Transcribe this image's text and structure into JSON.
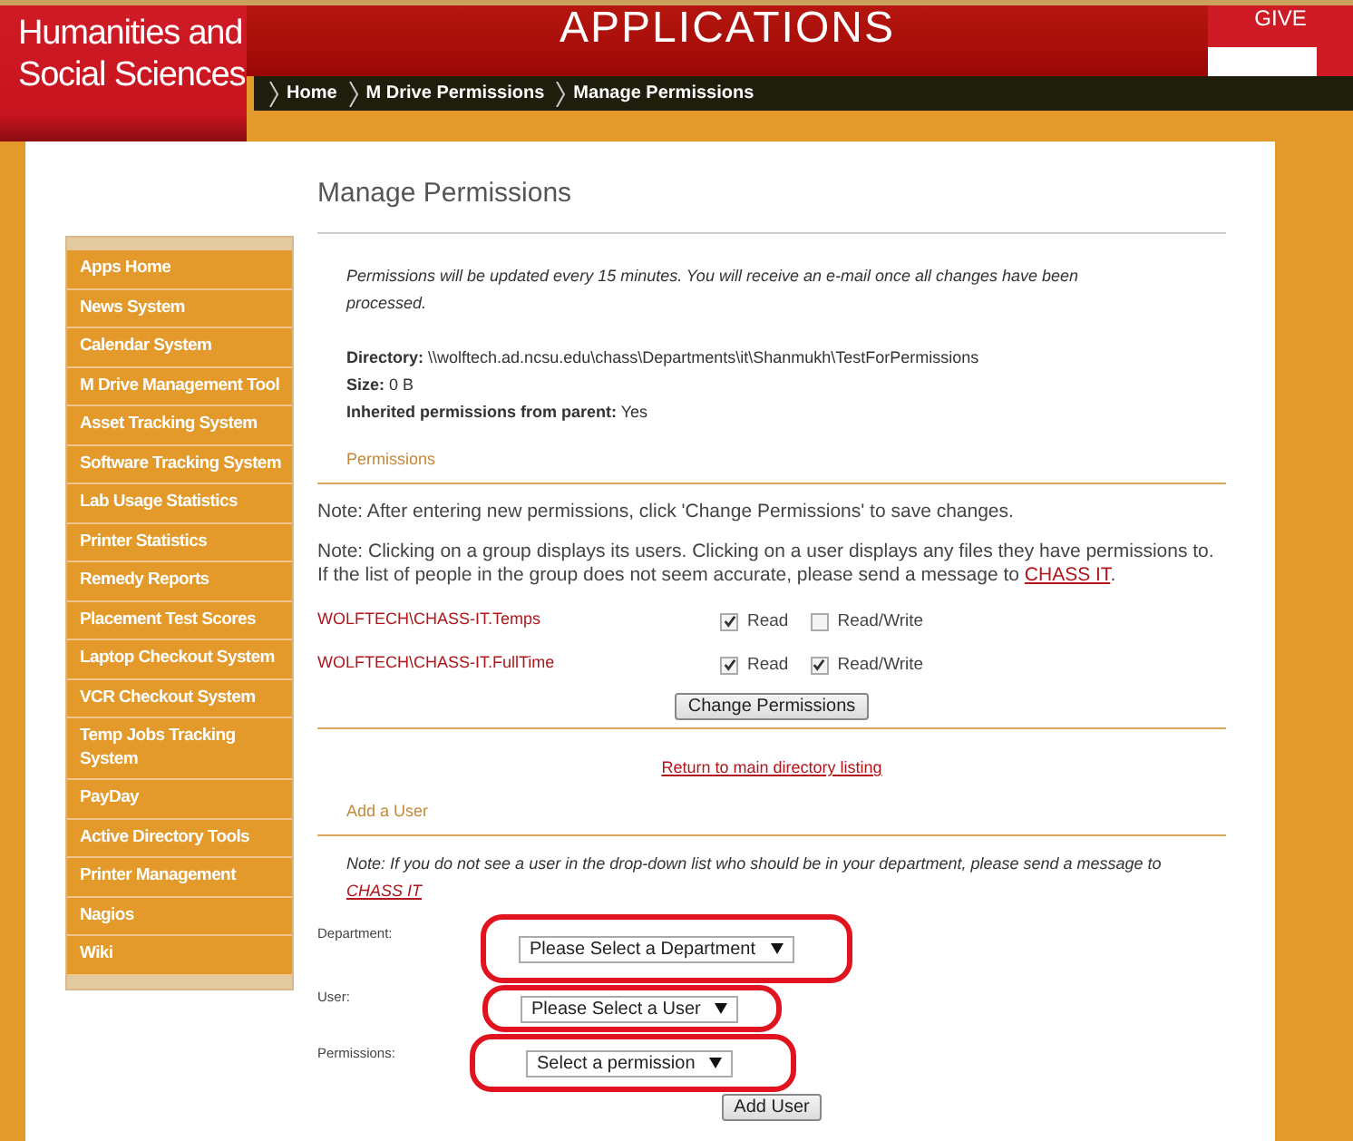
{
  "header": {
    "college": "Humanities and Social Sciences",
    "banner": "APPLICATIONS",
    "corner": "GIVE"
  },
  "breadcrumbs": [
    "Home",
    "M Drive Permissions",
    "Manage Permissions"
  ],
  "sidebar": {
    "items": [
      {
        "label": "Apps Home"
      },
      {
        "label": "News System"
      },
      {
        "label": "Calendar System"
      },
      {
        "label": "M Drive Management Tool"
      },
      {
        "label": "Asset Tracking System"
      },
      {
        "label": "Software Tracking System"
      },
      {
        "label": "Lab Usage Statistics"
      },
      {
        "label": "Printer Statistics"
      },
      {
        "label": "Remedy Reports"
      },
      {
        "label": "Placement Test Scores"
      },
      {
        "label": "Laptop Checkout System"
      },
      {
        "label": "VCR Checkout System"
      },
      {
        "label": "Temp Jobs Tracking System"
      },
      {
        "label": "PayDay"
      },
      {
        "label": "Active Directory Tools"
      },
      {
        "label": "Printer Management"
      },
      {
        "label": "Nagios"
      },
      {
        "label": "Wiki"
      }
    ]
  },
  "title": "Manage Permissions",
  "notice": "Permissions will be updated every 15 minutes. You will receive an e-mail once all changes have been processed.",
  "details": [
    {
      "label": "Directory:",
      "value": "\\\\wolftech.ad.ncsu.edu\\chass\\Departments\\it\\Shanmukh\\TestForPermissions"
    },
    {
      "label": "Size:",
      "value": "0 B"
    },
    {
      "label": "Inherited permissions from parent:",
      "value": "Yes"
    }
  ],
  "permissions": {
    "heading": "Permissions",
    "note_1": "Note: After entering new permissions, click 'Change Permissions' to save changes.",
    "note_2": {
      "text": "Note: Clicking on a group displays its users. Clicking on a user displays any files they have permissions to. If the list of people in the group does not seem accurate, please send a message to",
      "link": "CHASS IT",
      "after": "."
    },
    "groups": [
      {
        "name": "WOLFTECH\\CHASS-IT.Temps",
        "read_label": "Read",
        "read": true,
        "write_label": "Read/Write",
        "write": false
      },
      {
        "name": "WOLFTECH\\CHASS-IT.FullTime",
        "read_label": "Read",
        "read": true,
        "write_label": "Read/Write",
        "write": true
      }
    ],
    "button": "Change Permissions"
  },
  "return_link": "Return to main directory listing",
  "add_user": {
    "heading": "Add a User",
    "note": {
      "text": "Note: If you do not see a user in the drop-down list who should be in your department, please send a message to",
      "link": "CHASS IT"
    },
    "fields": [
      {
        "label": "Department:",
        "value": "Please Select a Department"
      },
      {
        "label": "User:",
        "value": "Please Select a User"
      },
      {
        "label": "Permissions:",
        "value": "Select a permission"
      }
    ],
    "button": "Add User"
  }
}
